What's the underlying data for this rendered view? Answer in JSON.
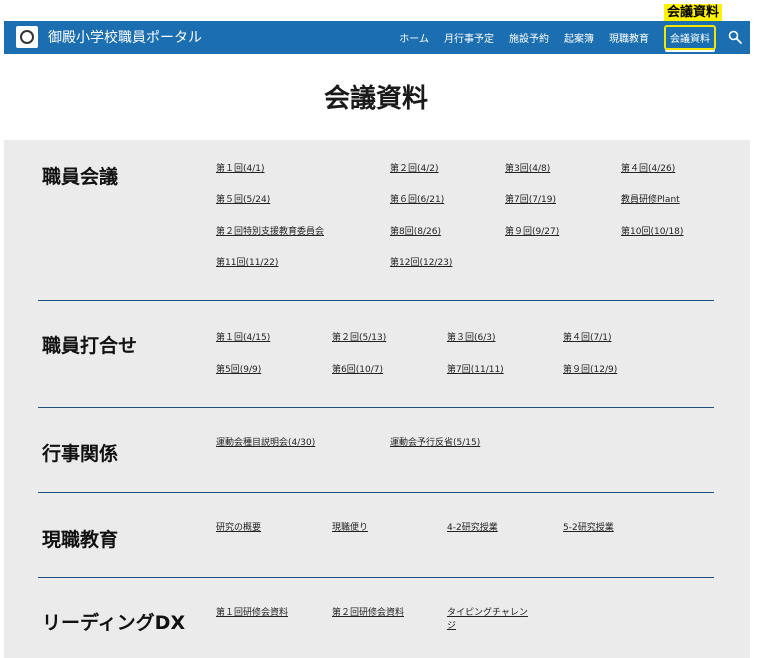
{
  "callout": {
    "label": "会議資料"
  },
  "nav": {
    "brand": "御殿小学校職員ポータル",
    "items": [
      "ホーム",
      "月行事予定",
      "施設予約",
      "起案簿",
      "現職教育",
      "会議資料"
    ],
    "active_index": 5,
    "search_icon": "search-icon"
  },
  "page": {
    "title": "会議資料"
  },
  "sections": [
    {
      "title": "職員会議",
      "links": [
        "第１回(4/1)",
        "第２回(4/2)",
        "第3回(4/8)",
        "第４回(4/26)",
        "第５回(5/24)",
        "第６回(6/21)",
        "第7回(7/19)",
        "教員研修Plant",
        "第２回特別支援教育委員会",
        "第8回(8/26)",
        "第９回(9/27)",
        "第10回(10/18)",
        "第11回(11/22)",
        "第12回(12/23)"
      ]
    },
    {
      "title": "職員打合せ",
      "links": [
        "第１回(4/15)",
        "第２回(5/13)",
        "第３回(6/3)",
        "第４回(7/1)",
        "第5回(9/9)",
        "第6回(10/7)",
        "第7回(11/11)",
        "第９回(12/9)"
      ]
    },
    {
      "title": "行事関係",
      "links": [
        "運動会種目説明会(4/30)",
        "運動会予行反省(5/15)"
      ]
    },
    {
      "title": "現職教育",
      "links": [
        "研究の概要",
        "現職便り",
        "4-2研究授業",
        "5-2研究授業"
      ]
    },
    {
      "title": "リーディングDX",
      "links": [
        "第１回研修会資料",
        "第２回研修会資料",
        "タイピングチャレンジ"
      ]
    }
  ],
  "colors": {
    "nav_bg": "#1b6fb0",
    "highlight": "#fff200",
    "panel_bg": "#ebebeb",
    "divider": "#1f4f7a"
  }
}
